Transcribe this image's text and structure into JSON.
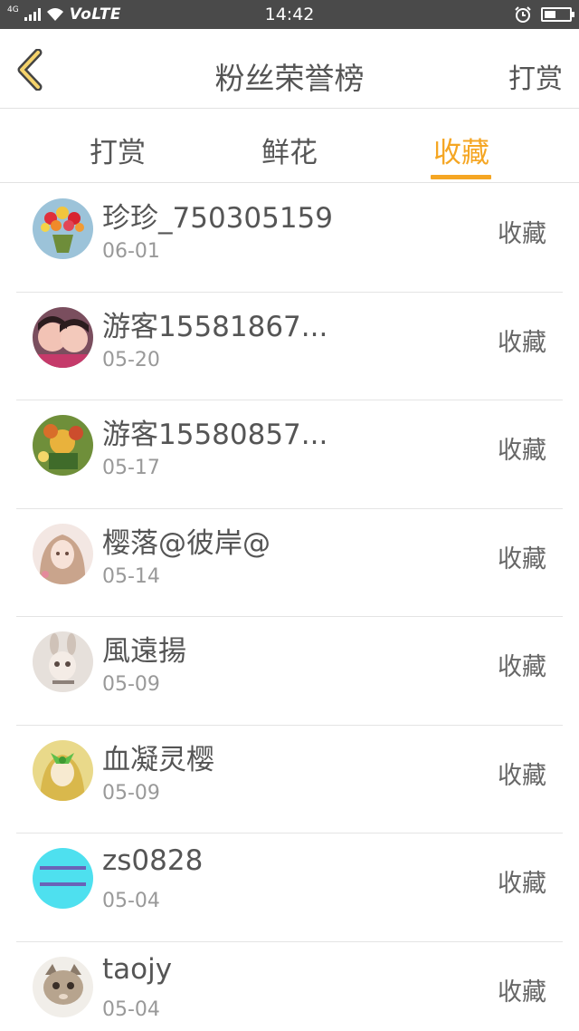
{
  "status_bar": {
    "network": "4G",
    "carrier": "VoLTE",
    "time": "14:42"
  },
  "header": {
    "title": "粉丝荣誉榜",
    "action": "打赏"
  },
  "tabs": [
    {
      "label": "打赏"
    },
    {
      "label": "鲜花"
    },
    {
      "label": "收藏"
    }
  ],
  "active_tab": "收藏",
  "accent_color": "#f5a623",
  "fans": [
    {
      "name": "珍珍_750305159",
      "date": "06-01",
      "action": "收藏",
      "avatar": "flowers-avatar"
    },
    {
      "name": "游客15581867...",
      "date": "05-20",
      "action": "收藏",
      "avatar": "children-photo-avatar"
    },
    {
      "name": "游客15580857...",
      "date": "05-17",
      "action": "收藏",
      "avatar": "cartoon-avatar"
    },
    {
      "name": "樱落@彼岸@",
      "date": "05-14",
      "action": "收藏",
      "avatar": "anime-girl-avatar"
    },
    {
      "name": "風遠揚",
      "date": "05-09",
      "action": "收藏",
      "avatar": "doll-avatar"
    },
    {
      "name": "血凝灵樱",
      "date": "05-09",
      "action": "收藏",
      "avatar": "green-ribbon-avatar"
    },
    {
      "name": "zs0828",
      "date": "05-04",
      "action": "收藏",
      "avatar": "text-avatar"
    },
    {
      "name": "taojy",
      "date": "05-04",
      "action": "收藏",
      "avatar": "kitten-avatar"
    }
  ]
}
